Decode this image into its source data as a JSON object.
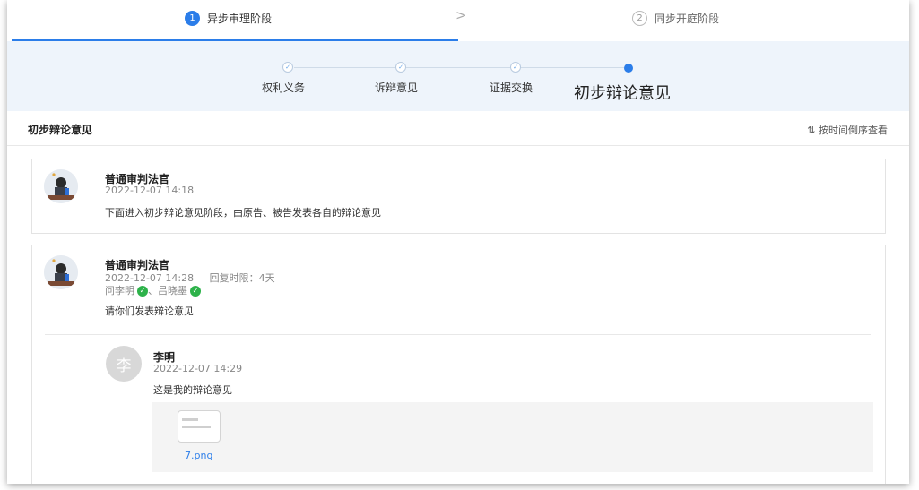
{
  "phases": [
    {
      "num": "1",
      "label": "异步审理阶段",
      "active": true
    },
    {
      "num": "2",
      "label": "同步开庭阶段",
      "active": false
    }
  ],
  "phase_separator": ">",
  "steps": [
    {
      "label": "权利义务",
      "status": "done"
    },
    {
      "label": "诉辩意见",
      "status": "done"
    },
    {
      "label": "证据交换",
      "status": "done"
    },
    {
      "label": "初步辩论意见",
      "status": "current"
    }
  ],
  "step_done_mark": "✓",
  "section": {
    "title": "初步辩论意见",
    "sort_label": "⇅ 按时间倒序查看"
  },
  "messages": [
    {
      "author": "普通审判法官",
      "time": "2022-12-07 14:18",
      "text": "下面进入初步辩论意见阶段，由原告、被告发表各自的辩论意见"
    },
    {
      "author": "普通审判法官",
      "time": "2022-12-07 14:28",
      "deadline": "回复时限：4天",
      "ask_prefix": "问李明",
      "ask_sep": "、吕晓墨",
      "check_mark": "✓",
      "text": "请你们发表辩论意见",
      "reply": {
        "avatar_char": "李",
        "author": "李明",
        "time": "2022-12-07 14:29",
        "text": "这是我的辩论意见",
        "attachment": "7.png"
      }
    }
  ],
  "colors": {
    "accent": "#2b7de9",
    "check_green": "#2db24a",
    "steps_bg": "#eef4fb"
  }
}
